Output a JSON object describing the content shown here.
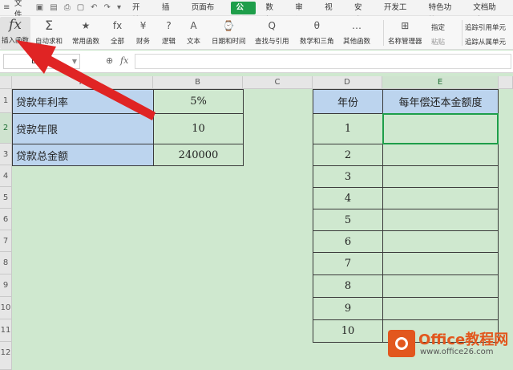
{
  "menubar": {
    "file_label": "文件",
    "tabs": [
      "开始",
      "插入",
      "页面布局",
      "公式",
      "数据",
      "审阅",
      "视图",
      "安全",
      "开发工具",
      "特色功能",
      "文档助手"
    ],
    "active_tab_index": 3
  },
  "ribbon": {
    "insert_function": {
      "icon": "fx",
      "label": "插入函数"
    },
    "buttons": [
      {
        "icon": "Σ",
        "label": "自动求和"
      },
      {
        "icon": "★",
        "label": "常用函数"
      },
      {
        "icon": "fx",
        "label": "全部"
      },
      {
        "icon": "¥",
        "label": "财务"
      },
      {
        "icon": "?",
        "label": "逻辑"
      },
      {
        "icon": "A",
        "label": "文本"
      },
      {
        "icon": "⌚",
        "label": "日期和时间"
      },
      {
        "icon": "Q",
        "label": "查找与引用"
      },
      {
        "icon": "θ",
        "label": "数学和三角"
      },
      {
        "icon": "…",
        "label": "其他函数"
      },
      {
        "icon": "⊞",
        "label": "名称管理器"
      }
    ],
    "side_items": [
      {
        "label": "指定",
        "dim": false
      },
      {
        "label": "粘贴",
        "dim": true
      },
      {
        "label": "追踪引用单元",
        "dim": false
      },
      {
        "label": "追踪从属单元",
        "dim": false
      }
    ]
  },
  "formula_bar": {
    "cell_ref": "E2",
    "zoom_icon": "magnifier-icon",
    "fx_label": "fx",
    "value": ""
  },
  "columns": [
    "A",
    "B",
    "C",
    "D",
    "E"
  ],
  "rows": [
    "1",
    "2",
    "3",
    "4",
    "5",
    "6",
    "7",
    "8",
    "9",
    "10",
    "11",
    "12"
  ],
  "sheet": {
    "labels": [
      "贷款年利率",
      "贷款年限",
      "贷款总金额"
    ],
    "values": [
      "5%",
      "10",
      "240000"
    ],
    "year_header": "年份",
    "amount_header": "每年偿还本金额度",
    "years": [
      "1",
      "2",
      "3",
      "4",
      "5",
      "6",
      "7",
      "8",
      "9",
      "10"
    ]
  },
  "watermark": {
    "brand": "Office教程网",
    "url": "www.office26.com"
  },
  "colors": {
    "accent": "#1e9e4a",
    "sheet_bg": "#cfe8cf",
    "label_bg": "#bcd4ee",
    "arrow": "#e02424"
  }
}
